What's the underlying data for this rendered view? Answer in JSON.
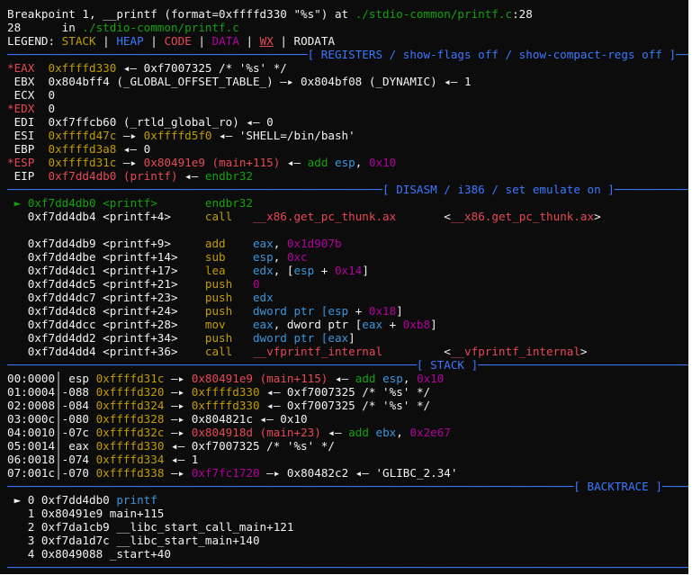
{
  "header": {
    "line1": [
      {
        "t": "Breakpoint 1, __printf (format=0xffffd330 \"%s\") at ",
        "c": "c-white"
      },
      {
        "t": "./stdio-common/printf.c",
        "c": "c-green"
      },
      {
        "t": ":28",
        "c": "c-white"
      }
    ],
    "line2": [
      {
        "t": "28      in ",
        "c": "c-white"
      },
      {
        "t": "./stdio-common/printf.c",
        "c": "c-green"
      }
    ],
    "legend": [
      {
        "t": "LEGEND: ",
        "c": "c-white"
      },
      {
        "t": "STACK",
        "c": "c-yellow"
      },
      {
        "t": " | ",
        "c": "c-white"
      },
      {
        "t": "HEAP",
        "c": "c-blue"
      },
      {
        "t": " | ",
        "c": "c-white"
      },
      {
        "t": "CODE",
        "c": "c-red"
      },
      {
        "t": " | ",
        "c": "c-white"
      },
      {
        "t": "DATA",
        "c": "c-purple"
      },
      {
        "t": " | ",
        "c": "c-white"
      },
      {
        "t": "WX",
        "c": "c-red u"
      },
      {
        "t": " | ",
        "c": "c-white"
      },
      {
        "t": "RODATA",
        "c": "c-white"
      }
    ]
  },
  "sections": {
    "registers": {
      "dashes_left": "────────────────────────────────────────────[ ",
      "title": "REGISTERS / show-flags off / show-compact-regs off",
      "dashes_right": " ]───────────"
    },
    "disasm": {
      "dashes_left": "───────────────────────────────────────────────────────[ ",
      "title": "DISASM / i386 / set emulate on",
      "dashes_right": " ]──────────────────────"
    },
    "stack": {
      "dashes_left": "────────────────────────────────────────────────────────────[ ",
      "title": "STACK",
      "dashes_right": " ]────────────────────────────────────────────────"
    },
    "backtrace": {
      "dashes_left": "───────────────────────────────────────────────────────────────────────────────────[ ",
      "title": "BACKTRACE",
      "dashes_right": " ]─────────────────────────────────"
    }
  },
  "registers": [
    [
      {
        "t": "*EAX  ",
        "c": "c-red"
      },
      {
        "t": "0xffffd330",
        "c": "c-yellow"
      },
      {
        "t": " ◂— 0xf7007325 /* '%s' */",
        "c": "c-white"
      }
    ],
    [
      {
        "t": " EBX  0x804bff4 (_GLOBAL_OFFSET_TABLE_) —▸ 0x804bf08 (_DYNAMIC) ◂— 1",
        "c": "c-white"
      }
    ],
    [
      {
        "t": " ECX  0",
        "c": "c-white"
      }
    ],
    [
      {
        "t": "*EDX  ",
        "c": "c-red"
      },
      {
        "t": "0",
        "c": "c-white"
      }
    ],
    [
      {
        "t": " EDI  0xf7ffcb60 (_rtld_global_ro) ◂— 0",
        "c": "c-white"
      }
    ],
    [
      {
        "t": " ESI  ",
        "c": "c-white"
      },
      {
        "t": "0xffffd47c",
        "c": "c-yellow"
      },
      {
        "t": " —▸ ",
        "c": "c-white"
      },
      {
        "t": "0xffffd5f0",
        "c": "c-yellow"
      },
      {
        "t": " ◂— 'SHELL=/bin/bash'",
        "c": "c-white"
      }
    ],
    [
      {
        "t": " EBP  ",
        "c": "c-white"
      },
      {
        "t": "0xffffd3a8",
        "c": "c-yellow"
      },
      {
        "t": " ◂— 0",
        "c": "c-white"
      }
    ],
    [
      {
        "t": "*ESP  ",
        "c": "c-red"
      },
      {
        "t": "0xffffd31c",
        "c": "c-yellow"
      },
      {
        "t": " —▸ ",
        "c": "c-white"
      },
      {
        "t": "0x80491e9 (main+115)",
        "c": "c-red"
      },
      {
        "t": " ◂— ",
        "c": "c-white"
      },
      {
        "t": "add ",
        "c": "c-green"
      },
      {
        "t": "esp",
        "c": "c-cyan"
      },
      {
        "t": ", ",
        "c": "c-white"
      },
      {
        "t": "0x10",
        "c": "c-purple"
      }
    ],
    [
      {
        "t": " EIP  ",
        "c": "c-white"
      },
      {
        "t": "0xf7dd4db0 (printf)",
        "c": "c-red"
      },
      {
        "t": " ◂— ",
        "c": "c-white"
      },
      {
        "t": "endbr32",
        "c": "c-green"
      }
    ]
  ],
  "disasm": [
    [
      {
        "t": " ► ",
        "c": "c-green"
      },
      {
        "t": "0xf7dd4db0 <printf>       ",
        "c": "c-green"
      },
      {
        "t": "endbr32",
        "c": "c-green"
      }
    ],
    [
      {
        "t": "   0xf7dd4db4 <printf+4>     ",
        "c": "c-white"
      },
      {
        "t": "call   ",
        "c": "c-yellow"
      },
      {
        "t": "__x86.get_pc_thunk.ax",
        "c": "c-red"
      },
      {
        "t": "       <",
        "c": "c-white"
      },
      {
        "t": "__x86.get_pc_thunk.ax",
        "c": "c-red"
      },
      {
        "t": ">",
        "c": "c-white"
      }
    ],
    [
      {
        "t": "",
        "c": "c-white"
      }
    ],
    [
      {
        "t": "   0xf7dd4db9 <printf+9>     ",
        "c": "c-white"
      },
      {
        "t": "add    ",
        "c": "c-yellow"
      },
      {
        "t": "eax",
        "c": "c-cyan"
      },
      {
        "t": ", ",
        "c": "c-white"
      },
      {
        "t": "0x1d907b",
        "c": "c-purple"
      }
    ],
    [
      {
        "t": "   0xf7dd4dbe <printf+14>    ",
        "c": "c-white"
      },
      {
        "t": "sub    ",
        "c": "c-yellow"
      },
      {
        "t": "esp",
        "c": "c-cyan"
      },
      {
        "t": ", ",
        "c": "c-white"
      },
      {
        "t": "0xc",
        "c": "c-purple"
      }
    ],
    [
      {
        "t": "   0xf7dd4dc1 <printf+17>    ",
        "c": "c-white"
      },
      {
        "t": "lea    ",
        "c": "c-yellow"
      },
      {
        "t": "edx",
        "c": "c-cyan"
      },
      {
        "t": ", [",
        "c": "c-white"
      },
      {
        "t": "esp",
        "c": "c-cyan"
      },
      {
        "t": " + ",
        "c": "c-white"
      },
      {
        "t": "0x14",
        "c": "c-purple"
      },
      {
        "t": "]",
        "c": "c-white"
      }
    ],
    [
      {
        "t": "   0xf7dd4dc5 <printf+21>    ",
        "c": "c-white"
      },
      {
        "t": "push   ",
        "c": "c-yellow"
      },
      {
        "t": "0",
        "c": "c-purple"
      }
    ],
    [
      {
        "t": "   0xf7dd4dc7 <printf+23>    ",
        "c": "c-white"
      },
      {
        "t": "push   ",
        "c": "c-yellow"
      },
      {
        "t": "edx",
        "c": "c-cyan"
      }
    ],
    [
      {
        "t": "   0xf7dd4dc8 <printf+24>    ",
        "c": "c-white"
      },
      {
        "t": "push   ",
        "c": "c-yellow"
      },
      {
        "t": "dword ptr [",
        "c": "c-cyan"
      },
      {
        "t": "esp",
        "c": "c-cyan"
      },
      {
        "t": " + ",
        "c": "c-white"
      },
      {
        "t": "0x18",
        "c": "c-purple"
      },
      {
        "t": "]",
        "c": "c-white"
      }
    ],
    [
      {
        "t": "   0xf7dd4dcc <printf+28>    ",
        "c": "c-white"
      },
      {
        "t": "mov    ",
        "c": "c-yellow"
      },
      {
        "t": "eax",
        "c": "c-cyan"
      },
      {
        "t": ", dword ptr [",
        "c": "c-white"
      },
      {
        "t": "eax",
        "c": "c-cyan"
      },
      {
        "t": " + ",
        "c": "c-white"
      },
      {
        "t": "0xb8",
        "c": "c-purple"
      },
      {
        "t": "]",
        "c": "c-white"
      }
    ],
    [
      {
        "t": "   0xf7dd4dd2 <printf+34>    ",
        "c": "c-white"
      },
      {
        "t": "push   ",
        "c": "c-yellow"
      },
      {
        "t": "dword ptr [",
        "c": "c-cyan"
      },
      {
        "t": "eax",
        "c": "c-cyan"
      },
      {
        "t": "]",
        "c": "c-white"
      }
    ],
    [
      {
        "t": "   0xf7dd4dd4 <printf+36>    ",
        "c": "c-white"
      },
      {
        "t": "call   ",
        "c": "c-yellow"
      },
      {
        "t": "__vfprintf_internal",
        "c": "c-red"
      },
      {
        "t": "         <",
        "c": "c-white"
      },
      {
        "t": "__vfprintf_internal",
        "c": "c-red"
      },
      {
        "t": ">",
        "c": "c-white"
      }
    ]
  ],
  "stack": [
    [
      {
        "t": "00:0000│ esp ",
        "c": "c-white"
      },
      {
        "t": "0xffffd31c",
        "c": "c-yellow"
      },
      {
        "t": " —▸ ",
        "c": "c-white"
      },
      {
        "t": "0x80491e9 (main+115)",
        "c": "c-red"
      },
      {
        "t": " ◂— ",
        "c": "c-white"
      },
      {
        "t": "add ",
        "c": "c-green"
      },
      {
        "t": "esp",
        "c": "c-cyan"
      },
      {
        "t": ", ",
        "c": "c-white"
      },
      {
        "t": "0x10",
        "c": "c-purple"
      }
    ],
    [
      {
        "t": "01:0004│-088 ",
        "c": "c-white"
      },
      {
        "t": "0xffffd320",
        "c": "c-yellow"
      },
      {
        "t": " —▸ ",
        "c": "c-white"
      },
      {
        "t": "0xffffd330",
        "c": "c-yellow"
      },
      {
        "t": " ◂— 0xf7007325 /* '%s' */",
        "c": "c-white"
      }
    ],
    [
      {
        "t": "02:0008│-084 ",
        "c": "c-white"
      },
      {
        "t": "0xffffd324",
        "c": "c-yellow"
      },
      {
        "t": " —▸ ",
        "c": "c-white"
      },
      {
        "t": "0xffffd330",
        "c": "c-yellow"
      },
      {
        "t": " ◂— 0xf7007325 /* '%s' */",
        "c": "c-white"
      }
    ],
    [
      {
        "t": "03:000c│-080 ",
        "c": "c-white"
      },
      {
        "t": "0xffffd328",
        "c": "c-yellow"
      },
      {
        "t": " —▸ 0x804821c ◂— 0x10",
        "c": "c-white"
      }
    ],
    [
      {
        "t": "04:0010│-07c ",
        "c": "c-white"
      },
      {
        "t": "0xffffd32c",
        "c": "c-yellow"
      },
      {
        "t": " —▸ ",
        "c": "c-white"
      },
      {
        "t": "0x804918d (main+23)",
        "c": "c-red"
      },
      {
        "t": " ◂— ",
        "c": "c-white"
      },
      {
        "t": "add ",
        "c": "c-green"
      },
      {
        "t": "ebx",
        "c": "c-cyan"
      },
      {
        "t": ", ",
        "c": "c-white"
      },
      {
        "t": "0x2e67",
        "c": "c-purple"
      }
    ],
    [
      {
        "t": "05:0014│ eax ",
        "c": "c-white"
      },
      {
        "t": "0xffffd330",
        "c": "c-yellow"
      },
      {
        "t": " ◂— 0xf7007325 /* '%s' */",
        "c": "c-white"
      }
    ],
    [
      {
        "t": "06:0018│-074 ",
        "c": "c-white"
      },
      {
        "t": "0xffffd334",
        "c": "c-yellow"
      },
      {
        "t": " ◂— 1",
        "c": "c-white"
      }
    ],
    [
      {
        "t": "07:001c│-070 ",
        "c": "c-white"
      },
      {
        "t": "0xffffd338",
        "c": "c-yellow"
      },
      {
        "t": " —▸ ",
        "c": "c-white"
      },
      {
        "t": "0xf7fc1720",
        "c": "c-purple"
      },
      {
        "t": " —▸ 0x80482c2 ◂— 'GLIBC_2.34'",
        "c": "c-white"
      }
    ]
  ],
  "backtrace": [
    [
      {
        "t": " ► 0 0xf7dd4db0 ",
        "c": "c-white"
      },
      {
        "t": "printf",
        "c": "c-cyan"
      }
    ],
    [
      {
        "t": "   1 0x80491e9 main+115",
        "c": "c-white"
      }
    ],
    [
      {
        "t": "   2 0xf7da1cb9 __libc_start_call_main+121",
        "c": "c-white"
      }
    ],
    [
      {
        "t": "   3 0xf7da1d7c __libc_start_main+140",
        "c": "c-white"
      }
    ],
    [
      {
        "t": "   4 0x8049088 _start+40",
        "c": "c-white"
      }
    ]
  ],
  "footer_rule": "───────────────────────────────────────────────────────────────────────────────────────────────────────────────",
  "colors": {
    "background": "#0c0c0c",
    "stack": "#c19c00",
    "heap": "#3b78ff",
    "code": "#e74856",
    "data": "#b4009e",
    "separator": "#3b78ff"
  }
}
